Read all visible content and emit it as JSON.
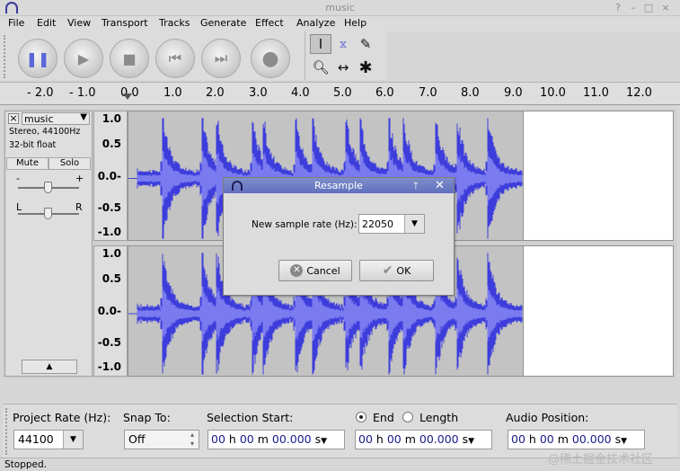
{
  "window": {
    "title": "music",
    "app_icon": "headphones-icon",
    "controls": [
      "?",
      "–",
      "□",
      "×"
    ]
  },
  "menu": [
    "File",
    "Edit",
    "View",
    "Transport",
    "Tracks",
    "Generate",
    "Effect",
    "Analyze",
    "Help"
  ],
  "transport": {
    "buttons": [
      "pause",
      "play",
      "stop",
      "skip-to-start",
      "skip-to-end",
      "record"
    ]
  },
  "tools": [
    "selection-tool",
    "envelope-tool",
    "draw-tool",
    "zoom-tool",
    "time-shift-tool",
    "multi-tool"
  ],
  "ruler": {
    "ticks": [
      "- 2.0",
      "- 1.0",
      "0.0",
      "1.0",
      "2.0",
      "3.0",
      "4.0",
      "5.0",
      "6.0",
      "7.0",
      "8.0",
      "9.0",
      "10.0",
      "11.0",
      "12.0"
    ]
  },
  "track": {
    "close": "×",
    "name": "music",
    "info1": "Stereo, 44100Hz",
    "info2": "32-bit float",
    "mute": "Mute",
    "solo": "Solo",
    "gain_minus": "-",
    "gain_plus": "+",
    "pan_left": "L",
    "pan_right": "R",
    "scale_top": [
      "1.0",
      "0.5",
      "0.0-",
      "-0.5",
      "-1.0"
    ],
    "scale_bottom": [
      "1.0",
      "0.5",
      "0.0-",
      "-0.5",
      "-1.0"
    ]
  },
  "dialog": {
    "title": "Resample",
    "label": "New sample rate (Hz):",
    "value": "22050",
    "cancel": "Cancel",
    "ok": "OK"
  },
  "selection_bar": {
    "project_rate_label": "Project Rate (Hz):",
    "project_rate": "44100",
    "snap_label": "Snap To:",
    "snap_value": "Off",
    "selection_start_label": "Selection Start:",
    "end_label": "End",
    "length_label": "Length",
    "audio_position_label": "Audio Position:",
    "time": {
      "hh": "00",
      "h": "h",
      "mm": "00",
      "m": "m",
      "ss": "00.000",
      "s": "s"
    }
  },
  "status": "Stopped.",
  "watermark": "@稀土掘金技术社区",
  "colors": {
    "waveform": "#3d3ddc",
    "waveform_light": "#7b7bf0",
    "dialog_title": "#6e7ec6"
  }
}
